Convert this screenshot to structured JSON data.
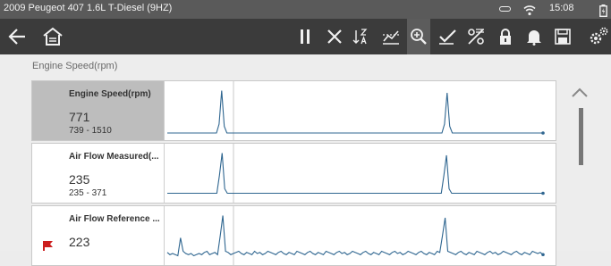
{
  "status_bar": {
    "vehicle_title": "2009 Peugeot 407 1.6L T-Diesel (9HZ)",
    "clock": "15:08",
    "icons": [
      "battery-icon",
      "wifi-icon",
      "battery-charging-icon"
    ]
  },
  "toolbar": {
    "left_icons": [
      "back-arrow-icon",
      "home-icon"
    ],
    "right_icons": [
      "pause-icon",
      "close-icon",
      "sort-icon",
      "trigger-icon",
      "zoom-icon",
      "checkmark-icon",
      "percent-icon",
      "lock-icon",
      "bell-icon",
      "save-icon",
      "settings-icon"
    ],
    "active": "zoom-icon"
  },
  "section_title": "Engine Speed(rpm)",
  "pids": [
    {
      "name": "Engine Speed(rpm)",
      "value": "771",
      "range": "739 - 1510",
      "selected": true,
      "flagged": false,
      "series": [
        0,
        0,
        0,
        0,
        0,
        0,
        0,
        0,
        0,
        0,
        0,
        0,
        0,
        0,
        0,
        0,
        0,
        0,
        0,
        0,
        8,
        38,
        6,
        0,
        0,
        0,
        0,
        0,
        0,
        0,
        0,
        0,
        0,
        0,
        0,
        0,
        0,
        0,
        0,
        0,
        0,
        0,
        0,
        0,
        0,
        0,
        0,
        0,
        0,
        0,
        0,
        0,
        0,
        0,
        0,
        0,
        0,
        0,
        0,
        0,
        0,
        0,
        0,
        0,
        0,
        0,
        0,
        0,
        0,
        0,
        0,
        0,
        0,
        0,
        0,
        0,
        0,
        0,
        0,
        0,
        0,
        0,
        0,
        0,
        0,
        0,
        0,
        0,
        0,
        0,
        0,
        0,
        0,
        0,
        0,
        0,
        0,
        0,
        0,
        0,
        0,
        0,
        0,
        0,
        0,
        0,
        0,
        8,
        36,
        6,
        0,
        0,
        0,
        0,
        0,
        0,
        0,
        0,
        0,
        0,
        0,
        0,
        0,
        0,
        0,
        0,
        0,
        0,
        0,
        0,
        0,
        0,
        0,
        0,
        0,
        0,
        0,
        0,
        0,
        0,
        0,
        0,
        0,
        0,
        0,
        0
      ]
    },
    {
      "name": "Air Flow Measured(...",
      "value": "235",
      "range": "235 - 371",
      "selected": false,
      "flagged": false,
      "series": [
        2,
        2,
        2,
        2,
        2,
        2,
        2,
        2,
        2,
        2,
        2,
        2,
        2,
        2,
        2,
        2,
        2,
        2,
        2,
        2,
        18,
        38,
        6,
        2,
        2,
        2,
        2,
        2,
        2,
        2,
        2,
        2,
        2,
        2,
        2,
        2,
        2,
        2,
        2,
        2,
        2,
        2,
        2,
        2,
        2,
        2,
        2,
        2,
        2,
        2,
        2,
        2,
        2,
        2,
        2,
        2,
        2,
        2,
        2,
        2,
        2,
        2,
        2,
        2,
        2,
        2,
        2,
        2,
        2,
        2,
        2,
        2,
        2,
        2,
        2,
        2,
        2,
        2,
        2,
        2,
        2,
        2,
        2,
        2,
        2,
        2,
        2,
        2,
        2,
        2,
        2,
        2,
        2,
        2,
        2,
        2,
        2,
        2,
        2,
        2,
        2,
        2,
        2,
        2,
        2,
        2,
        18,
        36,
        6,
        2,
        2,
        2,
        2,
        2,
        2,
        2,
        2,
        2,
        2,
        2,
        2,
        2,
        2,
        2,
        2,
        2,
        2,
        2,
        2,
        2,
        2,
        2,
        2,
        2,
        2,
        2,
        2,
        2,
        2,
        2,
        2,
        2,
        2,
        2,
        2
      ]
    },
    {
      "name": "Air Flow Reference ...",
      "value": "223",
      "range": "",
      "selected": false,
      "flagged": true,
      "series": [
        5,
        3,
        4,
        3,
        2,
        18,
        6,
        4,
        3,
        4,
        2,
        3,
        4,
        3,
        5,
        6,
        3,
        4,
        5,
        3,
        20,
        38,
        6,
        5,
        3,
        4,
        5,
        6,
        4,
        3,
        5,
        4,
        3,
        6,
        4,
        5,
        3,
        4,
        6,
        5,
        4,
        3,
        5,
        6,
        4,
        3,
        5,
        4,
        3,
        6,
        5,
        4,
        3,
        5,
        6,
        4,
        3,
        5,
        4,
        3,
        6,
        5,
        4,
        3,
        5,
        6,
        4,
        5,
        3,
        4,
        6,
        5,
        4,
        3,
        5,
        6,
        4,
        3,
        5,
        4,
        3,
        6,
        5,
        4,
        3,
        5,
        6,
        4,
        5,
        3,
        4,
        6,
        5,
        4,
        3,
        5,
        6,
        4,
        3,
        5,
        4,
        3,
        6,
        5,
        20,
        36,
        6,
        5,
        4,
        3,
        5,
        6,
        4,
        3,
        5,
        4,
        3,
        6,
        5,
        4,
        3,
        5,
        6,
        4,
        5,
        3,
        4,
        6,
        5,
        4,
        3,
        5,
        6,
        4,
        3,
        5,
        4,
        3,
        6,
        5,
        4,
        5,
        3
      ]
    }
  ],
  "colors": {
    "status_bar": "#5a5a5a",
    "toolbar": "#3b3b3b",
    "graph_line": "#2f6690",
    "cursor_line": "#c8c8c8",
    "flag": "#cc1f1f"
  }
}
